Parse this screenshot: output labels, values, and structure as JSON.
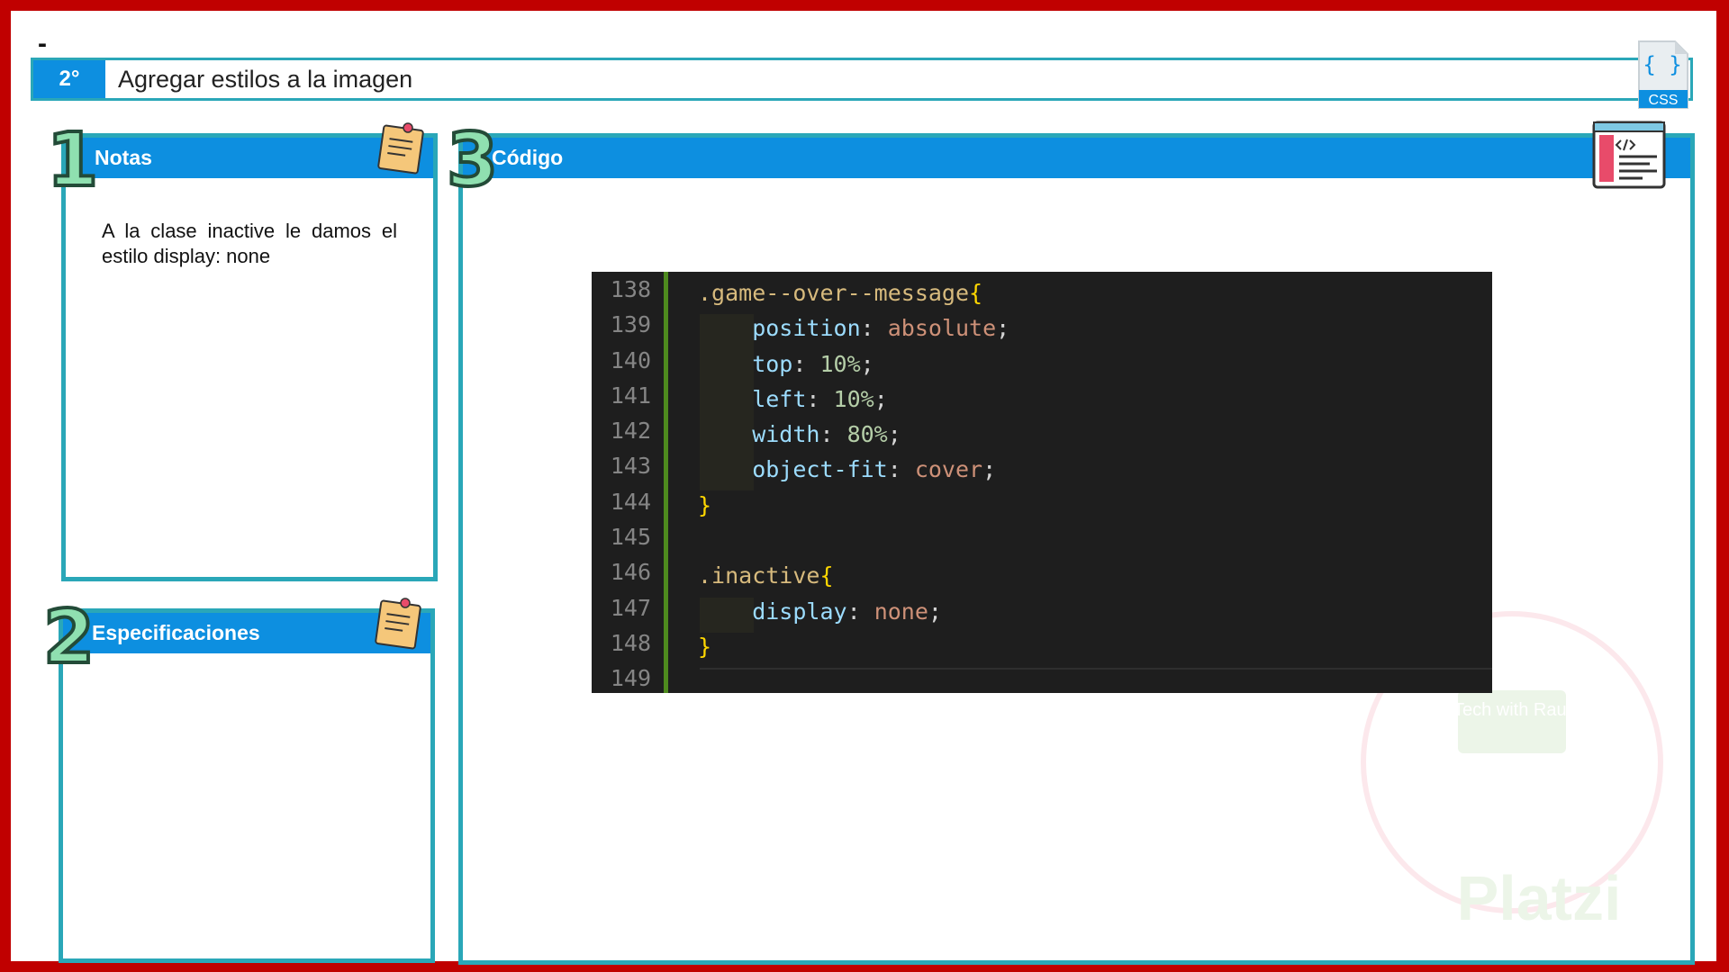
{
  "header": {
    "dash": "-",
    "step_number": "2°",
    "step_title": "Agregar estilos a la imagen",
    "css_badge_label": "CSS",
    "css_badge_braces": "{ }"
  },
  "notes": {
    "number": "1",
    "title": "Notas",
    "text": "A  la clase inactive le damos el estilo display: none"
  },
  "specs": {
    "number": "2",
    "title": "Especificaciones"
  },
  "code_panel": {
    "number": "3",
    "title": "Código",
    "line_numbers": [
      "138",
      "139",
      "140",
      "141",
      "142",
      "143",
      "144",
      "145",
      "146",
      "147",
      "148",
      "149"
    ],
    "lines": [
      [
        {
          "t": ".game--over--message",
          "c": "sel"
        },
        {
          "t": "{",
          "c": "br"
        }
      ],
      [
        {
          "t": "    position",
          "c": "prop"
        },
        {
          "t": ": ",
          "c": "pun"
        },
        {
          "t": "absolute",
          "c": "val"
        },
        {
          "t": ";",
          "c": "pun"
        }
      ],
      [
        {
          "t": "    top",
          "c": "prop"
        },
        {
          "t": ": ",
          "c": "pun"
        },
        {
          "t": "10%",
          "c": "num"
        },
        {
          "t": ";",
          "c": "pun"
        }
      ],
      [
        {
          "t": "    left",
          "c": "prop"
        },
        {
          "t": ": ",
          "c": "pun"
        },
        {
          "t": "10%",
          "c": "num"
        },
        {
          "t": ";",
          "c": "pun"
        }
      ],
      [
        {
          "t": "    width",
          "c": "prop"
        },
        {
          "t": ": ",
          "c": "pun"
        },
        {
          "t": "80%",
          "c": "num"
        },
        {
          "t": ";",
          "c": "pun"
        }
      ],
      [
        {
          "t": "    object-fit",
          "c": "prop"
        },
        {
          "t": ": ",
          "c": "pun"
        },
        {
          "t": "cover",
          "c": "val"
        },
        {
          "t": ";",
          "c": "pun"
        }
      ],
      [
        {
          "t": "}",
          "c": "br"
        }
      ],
      [],
      [
        {
          "t": ".inactive",
          "c": "sel"
        },
        {
          "t": "{",
          "c": "br"
        }
      ],
      [
        {
          "t": "    display",
          "c": "prop"
        },
        {
          "t": ": ",
          "c": "pun"
        },
        {
          "t": "none",
          "c": "val"
        },
        {
          "t": ";",
          "c": "pun"
        }
      ],
      [
        {
          "t": "}",
          "c": "br"
        }
      ],
      []
    ]
  },
  "watermark": {
    "brand": "Platzi",
    "badge": "Tech with Raul"
  },
  "colors": {
    "frame": "#c00000",
    "header_blue": "#0d8fe0",
    "panel_border": "#2aa7b8",
    "code_bg": "#1e1e1e"
  }
}
